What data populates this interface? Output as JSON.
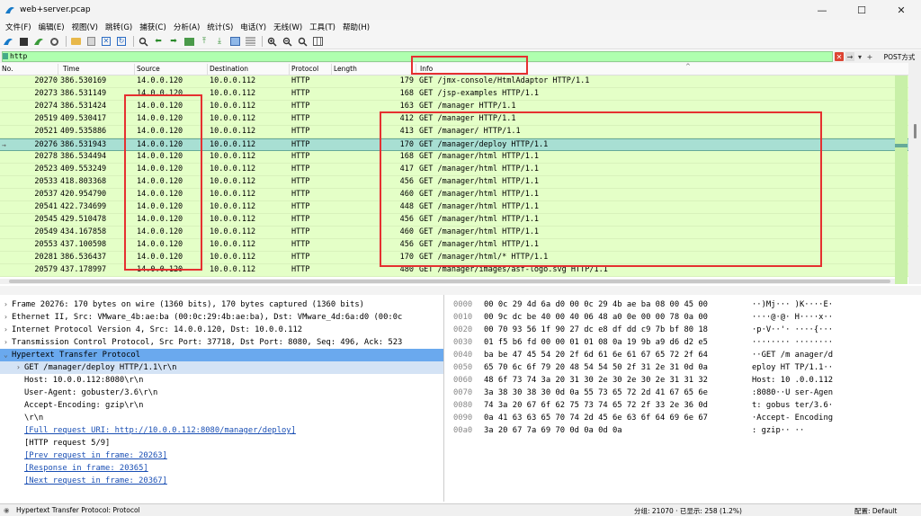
{
  "window": {
    "title": "web+server.pcap",
    "minimize": "—",
    "maximize": "☐",
    "close": "✕"
  },
  "menu": [
    "文件(F)",
    "编辑(E)",
    "视图(V)",
    "跳转(G)",
    "捕获(C)",
    "分析(A)",
    "统计(S)",
    "电话(Y)",
    "无线(W)",
    "工具(T)",
    "帮助(H)"
  ],
  "filter": {
    "value": "http",
    "expression_button": "POST方式"
  },
  "columns": {
    "no": "No.",
    "time": "Time",
    "source": "Source",
    "destination": "Destination",
    "protocol": "Protocol",
    "length": "Length",
    "info": "Info"
  },
  "packets": [
    {
      "no": "20270",
      "time": "386.530169",
      "src": "14.0.0.120",
      "dst": "10.0.0.112",
      "proto": "HTTP",
      "len": "179",
      "info": "GET /jmx-console/HtmlAdaptor HTTP/1.1"
    },
    {
      "no": "20273",
      "time": "386.531149",
      "src": "14.0.0.120",
      "dst": "10.0.0.112",
      "proto": "HTTP",
      "len": "168",
      "info": "GET /jsp-examples HTTP/1.1"
    },
    {
      "no": "20274",
      "time": "386.531424",
      "src": "14.0.0.120",
      "dst": "10.0.0.112",
      "proto": "HTTP",
      "len": "163",
      "info": "GET /manager HTTP/1.1"
    },
    {
      "no": "20519",
      "time": "409.530417",
      "src": "14.0.0.120",
      "dst": "10.0.0.112",
      "proto": "HTTP",
      "len": "412",
      "info": "GET /manager HTTP/1.1"
    },
    {
      "no": "20521",
      "time": "409.535886",
      "src": "14.0.0.120",
      "dst": "10.0.0.112",
      "proto": "HTTP",
      "len": "413",
      "info": "GET /manager/ HTTP/1.1"
    },
    {
      "no": "20276",
      "time": "386.531943",
      "src": "14.0.0.120",
      "dst": "10.0.0.112",
      "proto": "HTTP",
      "len": "170",
      "info": "GET /manager/deploy HTTP/1.1",
      "selected": true
    },
    {
      "no": "20278",
      "time": "386.534494",
      "src": "14.0.0.120",
      "dst": "10.0.0.112",
      "proto": "HTTP",
      "len": "168",
      "info": "GET /manager/html HTTP/1.1"
    },
    {
      "no": "20523",
      "time": "409.553249",
      "src": "14.0.0.120",
      "dst": "10.0.0.112",
      "proto": "HTTP",
      "len": "417",
      "info": "GET /manager/html HTTP/1.1"
    },
    {
      "no": "20533",
      "time": "418.803368",
      "src": "14.0.0.120",
      "dst": "10.0.0.112",
      "proto": "HTTP",
      "len": "456",
      "info": "GET /manager/html HTTP/1.1"
    },
    {
      "no": "20537",
      "time": "420.954790",
      "src": "14.0.0.120",
      "dst": "10.0.0.112",
      "proto": "HTTP",
      "len": "460",
      "info": "GET /manager/html HTTP/1.1"
    },
    {
      "no": "20541",
      "time": "422.734699",
      "src": "14.0.0.120",
      "dst": "10.0.0.112",
      "proto": "HTTP",
      "len": "448",
      "info": "GET /manager/html HTTP/1.1"
    },
    {
      "no": "20545",
      "time": "429.510478",
      "src": "14.0.0.120",
      "dst": "10.0.0.112",
      "proto": "HTTP",
      "len": "456",
      "info": "GET /manager/html HTTP/1.1"
    },
    {
      "no": "20549",
      "time": "434.167858",
      "src": "14.0.0.120",
      "dst": "10.0.0.112",
      "proto": "HTTP",
      "len": "460",
      "info": "GET /manager/html HTTP/1.1"
    },
    {
      "no": "20553",
      "time": "437.100598",
      "src": "14.0.0.120",
      "dst": "10.0.0.112",
      "proto": "HTTP",
      "len": "456",
      "info": "GET /manager/html HTTP/1.1"
    },
    {
      "no": "20281",
      "time": "386.536437",
      "src": "14.0.0.120",
      "dst": "10.0.0.112",
      "proto": "HTTP",
      "len": "170",
      "info": "GET /manager/html/* HTTP/1.1"
    },
    {
      "no": "20579",
      "time": "437.178997",
      "src": "14.0.0.120",
      "dst": "10.0.0.112",
      "proto": "HTTP",
      "len": "480",
      "info": "GET /manager/images/asf-logo.svg HTTP/1.1"
    }
  ],
  "details": [
    {
      "text": "Frame 20276: 170 bytes on wire (1360 bits), 170 bytes captured (1360 bits)",
      "indent": 0,
      "toggle": "›"
    },
    {
      "text": "Ethernet II, Src: VMware_4b:ae:ba (00:0c:29:4b:ae:ba), Dst: VMware_4d:6a:d0 (00:0c",
      "indent": 0,
      "toggle": "›"
    },
    {
      "text": "Internet Protocol Version 4, Src: 14.0.0.120, Dst: 10.0.0.112",
      "indent": 0,
      "toggle": "›"
    },
    {
      "text": "Transmission Control Protocol, Src Port: 37718, Dst Port: 8080, Seq: 496, Ack: 523",
      "indent": 0,
      "toggle": "›"
    },
    {
      "text": "Hypertext Transfer Protocol",
      "indent": 0,
      "toggle": "⌄",
      "highlight": "hl"
    },
    {
      "text": "GET /manager/deploy HTTP/1.1\\r\\n",
      "indent": 1,
      "toggle": "›",
      "highlight": "sub-hl"
    },
    {
      "text": "Host: 10.0.0.112:8080\\r\\n",
      "indent": 1,
      "toggle": ""
    },
    {
      "text": "User-Agent: gobuster/3.6\\r\\n",
      "indent": 1,
      "toggle": ""
    },
    {
      "text": "Accept-Encoding: gzip\\r\\n",
      "indent": 1,
      "toggle": ""
    },
    {
      "text": "\\r\\n",
      "indent": 1,
      "toggle": ""
    },
    {
      "text": "[Full request URI: http://10.0.0.112:8080/manager/deploy]",
      "indent": 1,
      "toggle": "",
      "link": true
    },
    {
      "text": "[HTTP request 5/9]",
      "indent": 1,
      "toggle": ""
    },
    {
      "text": "[Prev request in frame: 20263]",
      "indent": 1,
      "toggle": "",
      "link": true
    },
    {
      "text": "[Response in frame: 20365]",
      "indent": 1,
      "toggle": "",
      "link": true
    },
    {
      "text": "[Next request in frame: 20367]",
      "indent": 1,
      "toggle": "",
      "link": true
    }
  ],
  "bytes": [
    {
      "off": "0000",
      "hex": "00 0c 29 4d 6a d0 00 0c  29 4b ae ba 08 00 45 00",
      "asc": "··)Mj··· )K····E·"
    },
    {
      "off": "0010",
      "hex": "00 9c dc be 40 00 40 06  48 a0 0e 00 00 78 0a 00",
      "asc": "····@·@· H····x··"
    },
    {
      "off": "0020",
      "hex": "00 70 93 56 1f 90 27 dc  e8 df dd c9 7b bf 80 18",
      "asc": "·p·V··'· ····{···"
    },
    {
      "off": "0030",
      "hex": "01 f5 b6 fd 00 00 01 01  08 0a 19 9b a9 d6 d2 e5",
      "asc": "········ ········"
    },
    {
      "off": "0040",
      "hex": "ba be 47 45 54 20 2f 6d  61 6e 61 67 65 72 2f 64",
      "asc": "··GET /m anager/d"
    },
    {
      "off": "0050",
      "hex": "65 70 6c 6f 79 20 48 54  54 50 2f 31 2e 31 0d 0a",
      "asc": "eploy HT TP/1.1··"
    },
    {
      "off": "0060",
      "hex": "48 6f 73 74 3a 20 31 30  2e 30 2e 30 2e 31 31 32",
      "asc": "Host: 10 .0.0.112"
    },
    {
      "off": "0070",
      "hex": "3a 38 30 38 30 0d 0a 55  73 65 72 2d 41 67 65 6e",
      "asc": ":8080··U ser-Agen"
    },
    {
      "off": "0080",
      "hex": "74 3a 20 67 6f 62 75 73  74 65 72 2f 33 2e 36 0d",
      "asc": "t: gobus ter/3.6·"
    },
    {
      "off": "0090",
      "hex": "0a 41 63 63 65 70 74 2d  45 6e 63 6f 64 69 6e 67",
      "asc": "·Accept- Encoding"
    },
    {
      "off": "00a0",
      "hex": "3a 20 67 7a 69 70 0d 0a  0d 0a",
      "asc": ": gzip·· ··"
    }
  ],
  "status": {
    "left": "Hypertext Transfer Protocol: Protocol",
    "packets": "分组: 21070 · 已显示: 258 (1.2%)",
    "profile": "配置: Default"
  },
  "colors": {
    "row_bg": "#e4ffc7",
    "selected_bg": "#a8dfd3",
    "filter_bg": "#afffaf",
    "highlight_box": "#e53030",
    "tree_highlight": "#6aa9ee"
  }
}
